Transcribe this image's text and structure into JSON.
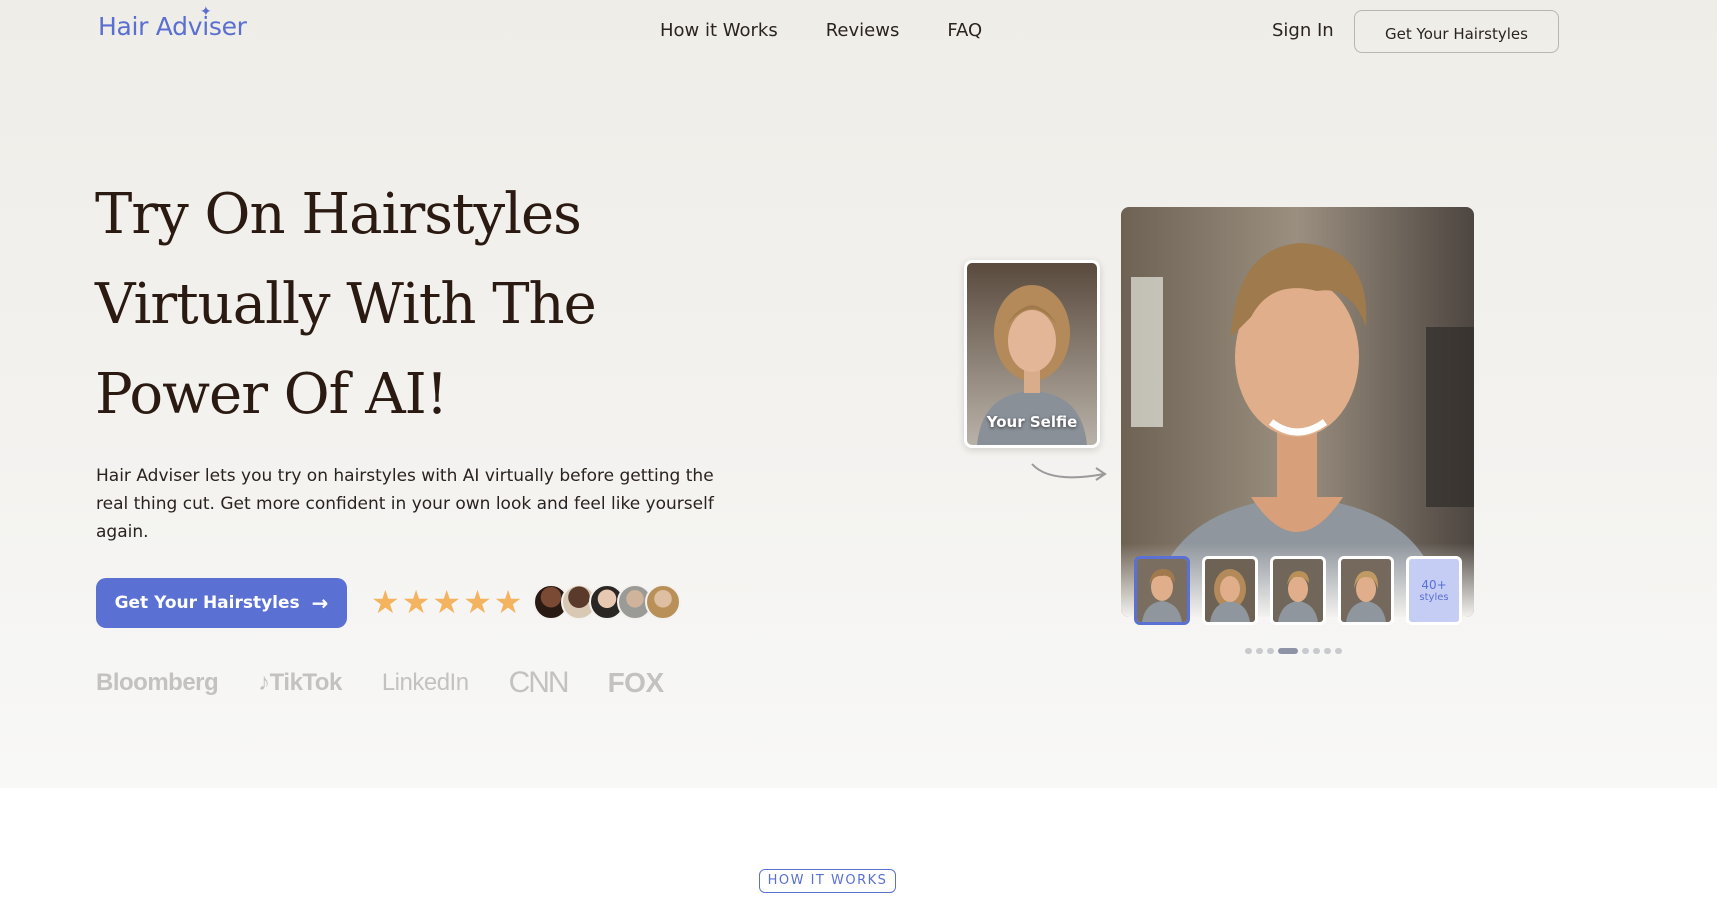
{
  "nav": {
    "logo": "Hair Adviser",
    "links": [
      "How it Works",
      "Reviews",
      "FAQ"
    ],
    "sign_in": "Sign In",
    "cta": "Get Your Hairstyles"
  },
  "hero": {
    "headline": "Try On Hairstyles Virtually With The Power Of AI!",
    "subtext": "Hair Adviser lets you try on hairstyles with AI virtually before getting the real thing cut. Get more confident in your own look and feel like yourself again.",
    "cta": "Get Your Hairstyles",
    "rating_stars": 5,
    "press": [
      "Bloomberg",
      "TikTok",
      "LinkedIn",
      "CNN",
      "FOX"
    ]
  },
  "preview": {
    "selfie_label": "Your Selfie",
    "more_count": "40+",
    "more_label": "styles",
    "thumbnail_count": 4,
    "active_thumbnail": 1,
    "dot_count": 8,
    "active_dot": 4
  },
  "section": {
    "badge": "HOW IT WORKS"
  },
  "colors": {
    "accent": "#5a70d2",
    "star": "#f3b35f",
    "heading": "#2a1a12"
  }
}
